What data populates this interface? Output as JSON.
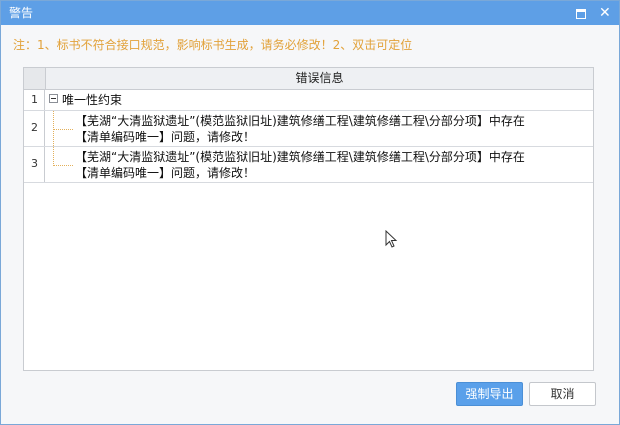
{
  "window": {
    "title": "警告",
    "maximize_icon": "maximize-icon",
    "close_icon": "close-icon",
    "close_glyph": "✕"
  },
  "note": "注：1、标书不符合接口规范，影响标书生成，请务必修改！2、双击可定位",
  "grid": {
    "header": "错误信息",
    "rows": [
      {
        "num": "1",
        "text": "唯一性约束",
        "expanded": true
      },
      {
        "num": "2",
        "line1": "【芜湖“大清监狱遗址”(模范监狱旧址)建筑修缮工程\\建筑修缮工程\\分部分项】中存在",
        "line2": "【清单编码唯一】问题，请修改！"
      },
      {
        "num": "3",
        "line1": "【芜湖“大清监狱遗址”(模范监狱旧址)建筑修缮工程\\建筑修缮工程\\分部分项】中存在",
        "line2": "【清单编码唯一】问题，请修改！"
      }
    ]
  },
  "buttons": {
    "force_export": "强制导出",
    "cancel": "取消"
  },
  "colors": {
    "titlebar": "#5e9fe6",
    "note": "#e2a23a",
    "primary_button": "#5aa0ea"
  }
}
